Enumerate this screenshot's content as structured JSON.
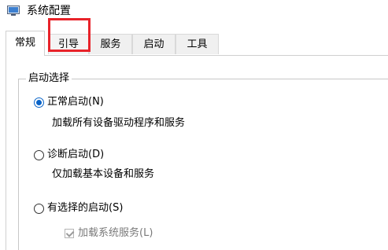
{
  "window": {
    "title": "系统配置",
    "icon": "msconfig-app-icon"
  },
  "tabs": [
    {
      "label": "常规",
      "active": true
    },
    {
      "label": "引导",
      "active": false,
      "highlighted": true
    },
    {
      "label": "服务",
      "active": false
    },
    {
      "label": "启动",
      "active": false
    },
    {
      "label": "工具",
      "active": false
    }
  ],
  "startup_selection": {
    "group_title": "启动选择",
    "options": [
      {
        "label": "正常启动(N)",
        "description": "加载所有设备驱动程序和服务",
        "checked": true
      },
      {
        "label": "诊断启动(D)",
        "description": "仅加载基本设备和服务",
        "checked": false
      },
      {
        "label": "有选择的启动(S)",
        "checked": false
      }
    ],
    "sub_options": [
      {
        "label": "加载系统服务(L)",
        "checked": true,
        "disabled": true
      }
    ]
  },
  "colors": {
    "highlight_box": "#e8232a",
    "radio_selected": "#0a64c8"
  }
}
